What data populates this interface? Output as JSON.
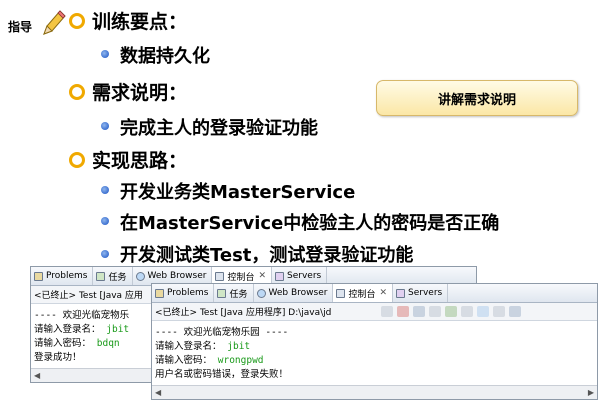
{
  "slide": {
    "guide_label": "指导",
    "items": [
      {
        "title": "训练要点：",
        "subs": [
          "数据持久化"
        ]
      },
      {
        "title": "需求说明：",
        "subs": [
          "完成主人的登录验证功能"
        ]
      },
      {
        "title": "实现思路：",
        "subs": [
          "开发业务类MasterService",
          "在MasterService中检验主人的密码是否正确",
          "开发测试类Test，测试登录验证功能"
        ]
      }
    ],
    "explain_button": "讲解需求说明"
  },
  "back_console": {
    "tabs": [
      "Problems",
      "任务",
      "Web Browser",
      "控制台",
      "Servers"
    ],
    "header": "<已终止> Test [Java 应用",
    "lines": {
      "l1": "---- 欢迎光临宠物乐",
      "l2_label": "请输入登录名：",
      "l2_value": "jbit",
      "l3_label": "请输入密码：",
      "l3_value": "bdqn",
      "l4": "登录成功！"
    }
  },
  "front_console": {
    "tabs": [
      "Problems",
      "任务",
      "Web Browser",
      "控制台",
      "Servers"
    ],
    "header": "<已终止> Test [Java 应用程序] D:\\java\\jd",
    "lines": {
      "l1": "---- 欢迎光临宠物乐园 ----",
      "l2_label": "请输入登录名：",
      "l2_value": "jbit",
      "l3_label": "请输入密码：",
      "l3_value": "wrongpwd",
      "l4": "用户名或密码错误，登录失败！"
    }
  },
  "colors": {
    "bullet_ring": "#f0a900",
    "bullet_dot": "#3b6fd0",
    "input_text": "#1a9a1a",
    "button_fill": "#fbe7a6"
  },
  "icons": [
    "pencil-icon",
    "problems-icon",
    "tasks-icon",
    "web-browser-icon",
    "console-icon",
    "servers-icon",
    "close-icon"
  ]
}
